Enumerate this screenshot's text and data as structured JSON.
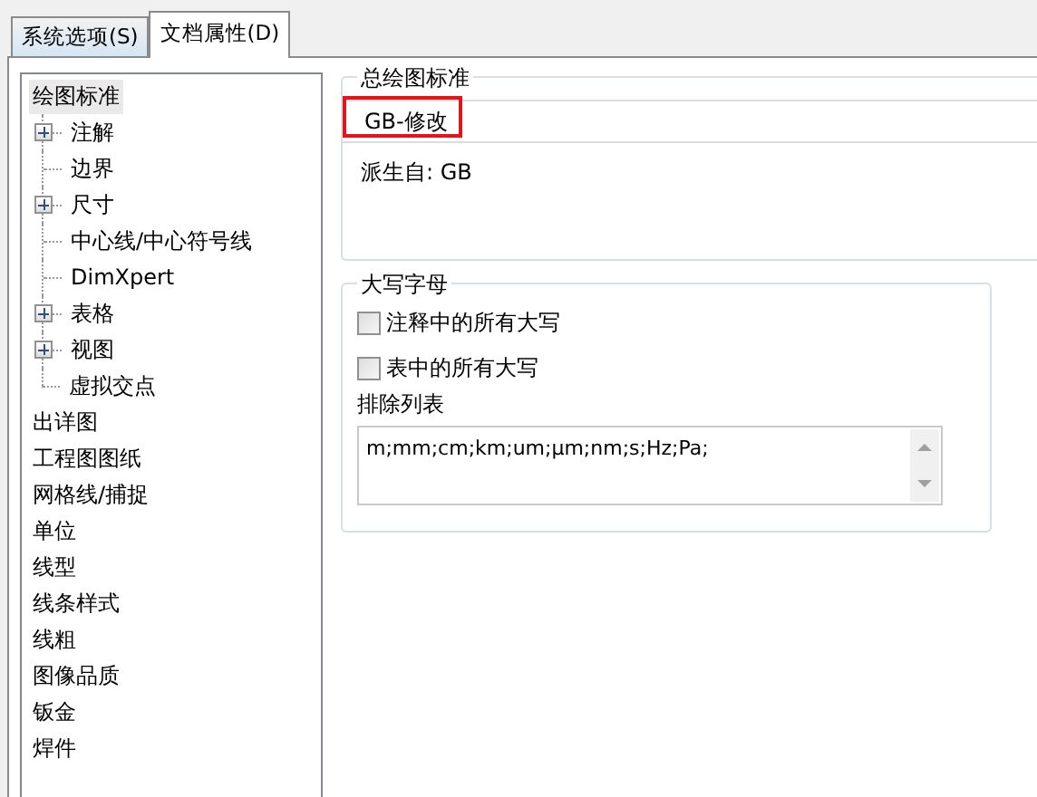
{
  "tabs": [
    {
      "label": "系统选项(S)",
      "selected": false
    },
    {
      "label": "文档属性(D)",
      "selected": true
    }
  ],
  "tree": [
    {
      "label": "绘图标准",
      "kind": "leaf",
      "selected": true,
      "children": [
        {
          "label": "注解",
          "kind": "node",
          "expanded": false,
          "selected": false
        },
        {
          "label": "边界",
          "kind": "leaf",
          "selected": false
        },
        {
          "label": "尺寸",
          "kind": "node",
          "expanded": false,
          "selected": false
        },
        {
          "label": "中心线/中心符号线",
          "kind": "leaf",
          "selected": false
        },
        {
          "label": "DimXpert",
          "kind": "leaf",
          "selected": false
        },
        {
          "label": "表格",
          "kind": "node",
          "expanded": false,
          "selected": false
        },
        {
          "label": "视图",
          "kind": "node",
          "expanded": false,
          "selected": false
        },
        {
          "label": "虚拟交点",
          "kind": "leaf",
          "selected": false
        }
      ]
    },
    {
      "label": "出详图",
      "kind": "leaf",
      "selected": false
    },
    {
      "label": "工程图图纸",
      "kind": "leaf",
      "selected": false
    },
    {
      "label": "网格线/捕捉",
      "kind": "leaf",
      "selected": false
    },
    {
      "label": "单位",
      "kind": "leaf",
      "selected": false
    },
    {
      "label": "线型",
      "kind": "leaf",
      "selected": false
    },
    {
      "label": "线条样式",
      "kind": "leaf",
      "selected": false
    },
    {
      "label": "线粗",
      "kind": "leaf",
      "selected": false
    },
    {
      "label": "图像品质",
      "kind": "leaf",
      "selected": false
    },
    {
      "label": "钣金",
      "kind": "leaf",
      "selected": false
    },
    {
      "label": "焊件",
      "kind": "leaf",
      "selected": false
    }
  ],
  "standard_group": {
    "title": "总绘图标准",
    "value": "GB-修改",
    "highlighted": true,
    "derived": "派生自: GB"
  },
  "caps_group": {
    "title": "大写字母",
    "checkboxes": [
      {
        "label": "注释中的所有大写",
        "checked": false
      },
      {
        "label": "表中的所有大写",
        "checked": false
      }
    ],
    "exclude_label": "排除列表",
    "exclude_value": "m;mm;cm;km;um;µm;nm;s;Hz;Pa;"
  }
}
